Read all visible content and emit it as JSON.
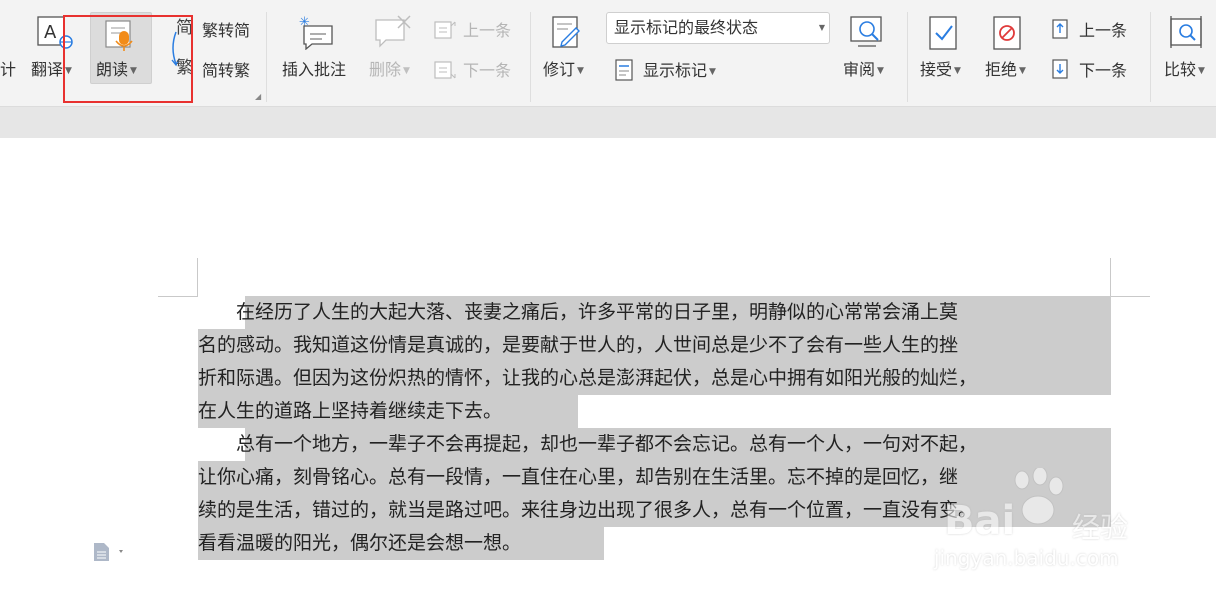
{
  "ribbon": {
    "left_partial": "计",
    "translate": "翻译",
    "read_aloud": "朗读",
    "trad_icon_top": "简",
    "trad_icon_bottom": "繁",
    "to_simplified": "繁转简",
    "to_traditional": "简转繁",
    "insert_comment": "插入批注",
    "delete": "删除",
    "prev_comment": "上一条",
    "next_comment": "下一条",
    "track_changes": "修订",
    "display_select": "显示标记的最终状态",
    "show_markup": "显示标记",
    "review": "审阅",
    "accept": "接受",
    "reject": "拒绝",
    "prev_change": "上一条",
    "next_change": "下一条",
    "compare": "比较"
  },
  "document": {
    "lines": [
      "　　在经历了人生的大起大落、丧妻之痛后，许多平常的日子里，明静似的心常常会涌上莫",
      "名的感动。我知道这份情是真诚的，是要献于世人的，人世间总是少不了会有一些人生的挫",
      "折和际遇。但因为这份炽热的情怀，让我的心总是澎湃起伏，总是心中拥有如阳光般的灿烂，",
      "在人生的道路上坚持着继续走下去。",
      "　　总有一个地方，一辈子不会再提起，却也一辈子都不会忘记。总有一个人，一句对不起，",
      "让你心痛，刻骨铭心。总有一段情，一直住在心里，却告别在生活里。忘不掉的是回忆，继",
      "续的是生活，错过的，就当是路过吧。来往身边出现了很多人，总有一个位置，一直没有变。",
      "看看温暖的阳光，偶尔还是会想一想。"
    ]
  },
  "watermark": {
    "brand": "Bai",
    "brand_suffix": "经验",
    "url": "jingyan.baidu.com"
  }
}
